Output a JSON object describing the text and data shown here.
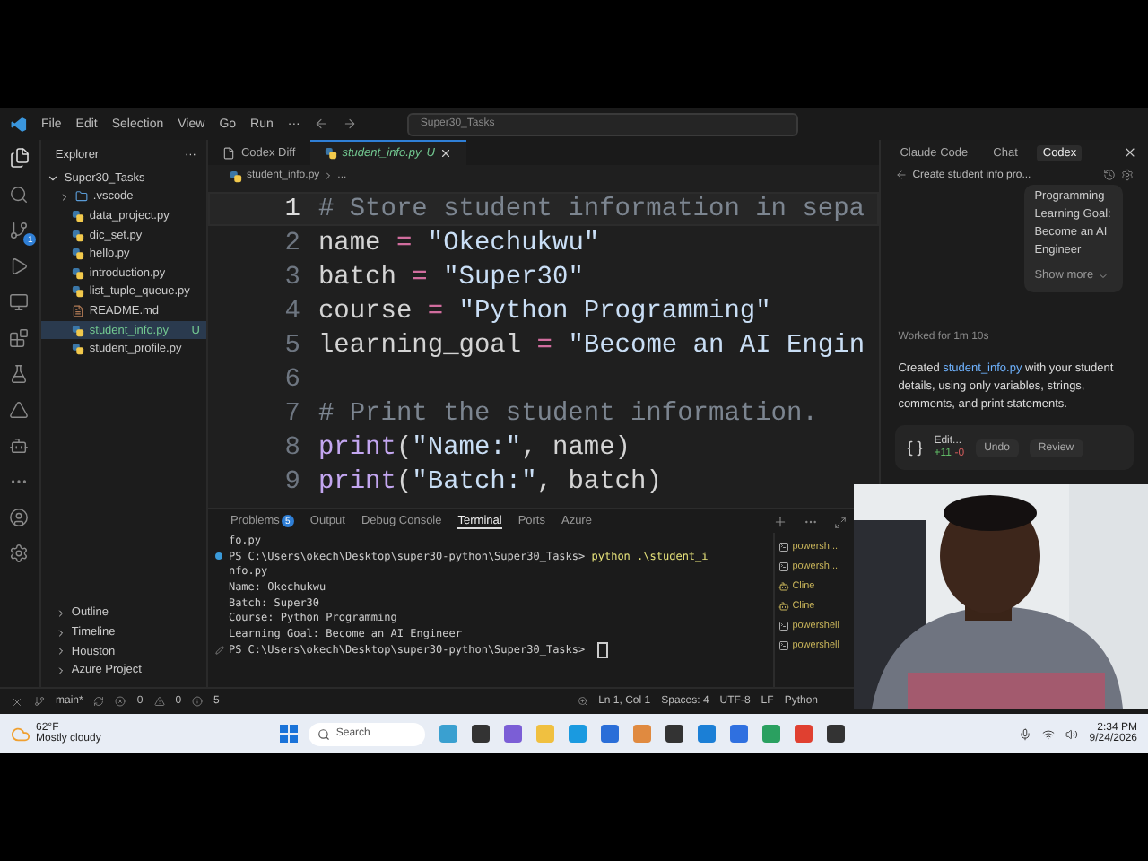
{
  "title_bar": {
    "menu": [
      "File",
      "Edit",
      "Selection",
      "View",
      "Go",
      "Run",
      "···"
    ],
    "search": "Super30_Tasks"
  },
  "activity_bar": {
    "badge": "1"
  },
  "explorer": {
    "title": "Explorer",
    "more": "···",
    "folder": "Super30_Tasks",
    "expanded": true,
    "files": [
      {
        "name": ".vscode",
        "kind": "folder",
        "selected": false
      },
      {
        "name": "data_project.py",
        "kind": "python",
        "selected": false
      },
      {
        "name": "dic_set.py",
        "kind": "python",
        "selected": false
      },
      {
        "name": "hello.py",
        "kind": "python",
        "selected": false
      },
      {
        "name": "introduction.py",
        "kind": "python",
        "selected": false
      },
      {
        "name": "list_tuple_queue.py",
        "kind": "python",
        "selected": false
      },
      {
        "name": "README.md",
        "kind": "markdown",
        "selected": false
      },
      {
        "name": "student_info.py",
        "kind": "python",
        "selected": true,
        "status": "U"
      },
      {
        "name": "student_profile.py",
        "kind": "python",
        "selected": false
      }
    ],
    "sections": [
      "Outline",
      "Timeline",
      "Houston",
      "Azure Project"
    ]
  },
  "editor": {
    "tabs": [
      {
        "label": "Codex Diff",
        "kind": "file",
        "selected": false
      },
      {
        "label": "student_info.py",
        "kind": "python",
        "selected": true,
        "status": "U"
      }
    ],
    "breadcrumb": [
      "student_info.py",
      "..."
    ],
    "lines": [
      {
        "number": "1",
        "current": true,
        "tokens": [
          {
            "kind": "comment",
            "text": "# Store student information in sepa"
          }
        ]
      },
      {
        "number": "2",
        "current": false,
        "tokens": [
          {
            "kind": "name",
            "text": "name"
          },
          {
            "kind": "op",
            "text": " = "
          },
          {
            "kind": "string",
            "text": "\"Okechukwu\""
          }
        ]
      },
      {
        "number": "3",
        "current": false,
        "tokens": [
          {
            "kind": "name",
            "text": "batch"
          },
          {
            "kind": "op",
            "text": " = "
          },
          {
            "kind": "string",
            "text": "\"Super30\""
          }
        ]
      },
      {
        "number": "4",
        "current": false,
        "tokens": [
          {
            "kind": "name",
            "text": "course"
          },
          {
            "kind": "op",
            "text": " = "
          },
          {
            "kind": "string",
            "text": "\"Python Programming\""
          }
        ]
      },
      {
        "number": "5",
        "current": false,
        "tokens": [
          {
            "kind": "name",
            "text": "learning_goal"
          },
          {
            "kind": "op",
            "text": " = "
          },
          {
            "kind": "string",
            "text": "\"Become an AI Engin"
          }
        ]
      },
      {
        "number": "6",
        "current": false
      },
      {
        "number": "7",
        "current": false,
        "tokens": [
          {
            "kind": "comment",
            "text": "# Print the student information."
          }
        ]
      },
      {
        "number": "8",
        "current": false,
        "tokens": [
          {
            "kind": "call",
            "text": "print"
          },
          {
            "kind": "plain",
            "text": "("
          },
          {
            "kind": "string",
            "text": "\"Name:\""
          },
          {
            "kind": "plain",
            "text": ", name)"
          }
        ]
      },
      {
        "number": "9",
        "current": false,
        "tokens": [
          {
            "kind": "call",
            "text": "print"
          },
          {
            "kind": "plain",
            "text": "("
          },
          {
            "kind": "string",
            "text": "\"Batch:\""
          },
          {
            "kind": "plain",
            "text": ", batch)"
          }
        ]
      }
    ]
  },
  "terminal": {
    "tabs": [
      {
        "label": "Problems",
        "badge": "5",
        "selected": false
      },
      {
        "label": "Output",
        "selected": false
      },
      {
        "label": "Debug Console",
        "selected": false
      },
      {
        "label": "Terminal",
        "selected": true
      },
      {
        "label": "Ports",
        "selected": false
      },
      {
        "label": "Azure",
        "selected": false
      }
    ],
    "lines": [
      {
        "kind": "output",
        "text": "fo.py"
      },
      {
        "kind": "finished",
        "prompt": "PS C:\\Users\\okech\\Desktop\\super30-python\\Super30_Tasks>",
        "command": "python .\\student_i"
      },
      {
        "kind": "output",
        "text": "nfo.py"
      },
      {
        "kind": "output",
        "text": "Name: Okechukwu"
      },
      {
        "kind": "output",
        "text": "Batch: Super30"
      },
      {
        "kind": "output",
        "text": "Course: Python Programming"
      },
      {
        "kind": "output",
        "text": "Learning Goal: Become an AI Engineer"
      },
      {
        "kind": "current",
        "prompt": "PS C:\\Users\\okech\\Desktop\\super30-python\\Super30_Tasks>",
        "cursor": true
      }
    ],
    "sessions": [
      {
        "label": "powersh...",
        "kind": "shell"
      },
      {
        "label": "powersh...",
        "kind": "shell"
      },
      {
        "label": "Cline",
        "kind": "agent"
      },
      {
        "label": "Cline",
        "kind": "agent"
      },
      {
        "label": "powershell",
        "kind": "shell"
      },
      {
        "label": "powershell",
        "kind": "shell"
      }
    ]
  },
  "chat_panel": {
    "tabs": [
      {
        "label": "Claude Code",
        "selected": false
      },
      {
        "label": "Chat",
        "selected": false
      },
      {
        "label": "Codex",
        "selected": true
      }
    ],
    "header": "Create student info pro...",
    "message": "Programming Learning Goal: Become an AI Engineer",
    "show_more": "Show more",
    "worked": "Worked for 1m 10s",
    "reply": {
      "before": "Created",
      "link": "student_info.py",
      "after": "with your student details, using only variables, strings, comments, and print statements."
    },
    "edit_card": {
      "title": "Edit...",
      "added": "+11",
      "removed": "-0",
      "undo": "Undo",
      "review": "Review"
    }
  },
  "status_bar": {
    "branch": "main*",
    "errors": "0",
    "warnings": "0",
    "infos": "5",
    "right": [
      "Ln 1, Col 1",
      "Spaces: 4",
      "UTF-8",
      "LF",
      "Python"
    ]
  },
  "taskbar": {
    "temperature": "62°F",
    "weather": "Mostly cloudy",
    "search": "Search",
    "time": "2:34 PM",
    "date": "9/24/2026"
  }
}
